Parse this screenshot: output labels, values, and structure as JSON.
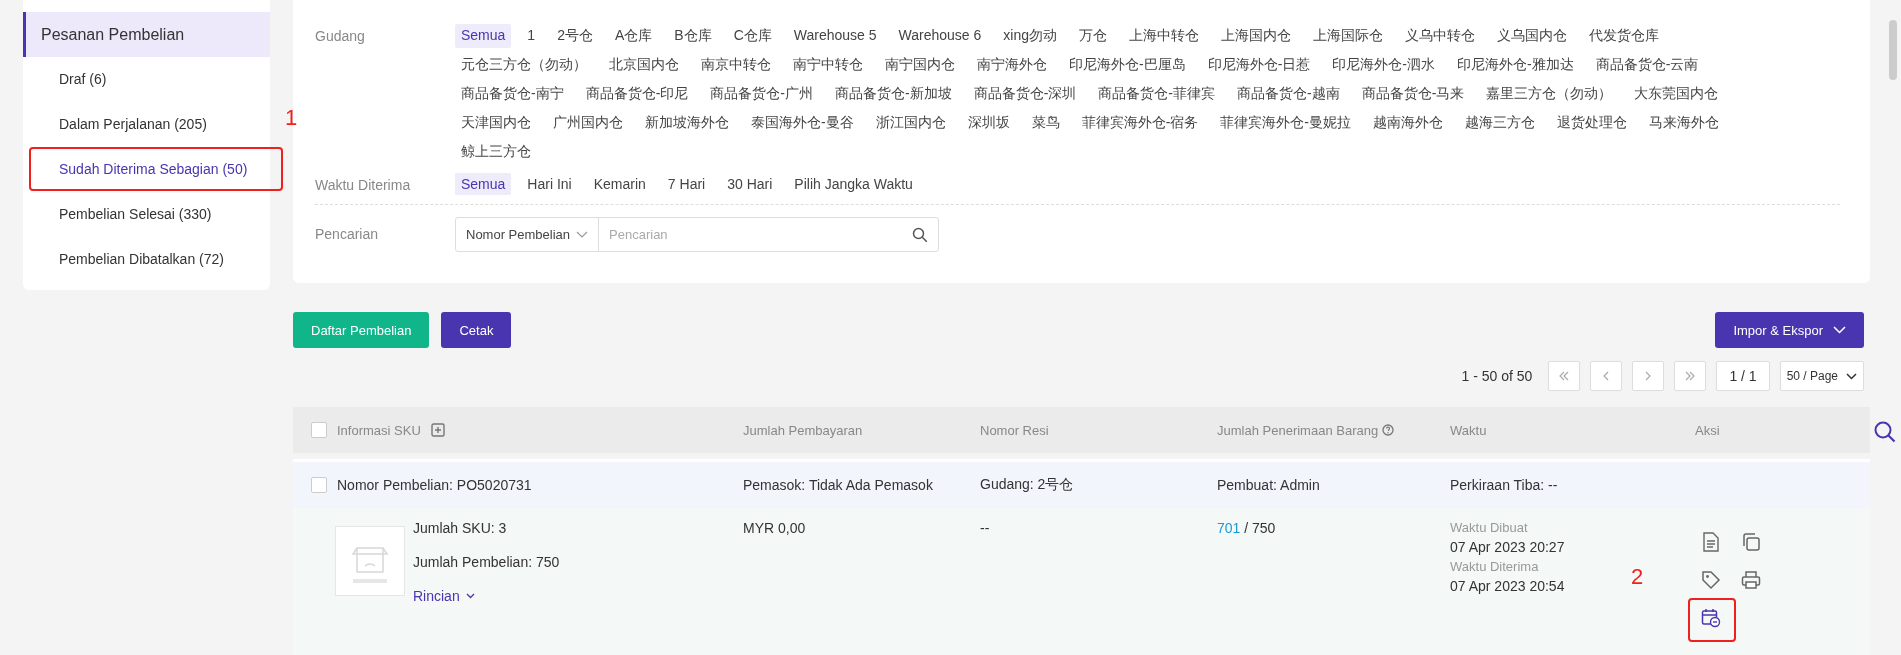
{
  "sidebar": {
    "title": "Pesanan Pembelian",
    "items": [
      {
        "label": "Draf (6)",
        "selected": false
      },
      {
        "label": "Dalam Perjalanan (205)",
        "selected": false
      },
      {
        "label": "Sudah Diterima Sebagian (50)",
        "selected": true,
        "annotation": "1"
      },
      {
        "label": "Pembelian Selesai (330)",
        "selected": false
      },
      {
        "label": "Pembelian Dibatalkan (72)",
        "selected": false
      }
    ]
  },
  "filter": {
    "warehouse": {
      "label": "Gudang",
      "options": [
        {
          "label": "Semua",
          "selected": true
        },
        {
          "label": "1",
          "selected": false
        },
        {
          "label": "2号仓",
          "selected": false
        },
        {
          "label": "A仓库",
          "selected": false
        },
        {
          "label": "B仓库",
          "selected": false
        },
        {
          "label": "C仓库",
          "selected": false
        },
        {
          "label": "Warehouse 5",
          "selected": false
        },
        {
          "label": "Warehouse 6",
          "selected": false
        },
        {
          "label": "xing勿动",
          "selected": false
        },
        {
          "label": "万仓",
          "selected": false
        },
        {
          "label": "上海中转仓",
          "selected": false
        },
        {
          "label": "上海国内仓",
          "selected": false
        },
        {
          "label": "上海国际仓",
          "selected": false
        },
        {
          "label": "义乌中转仓",
          "selected": false
        },
        {
          "label": "义乌国内仓",
          "selected": false
        },
        {
          "label": "代发货仓库",
          "selected": false
        },
        {
          "label": "元仓三方仓（勿动）",
          "selected": false
        },
        {
          "label": "北京国内仓",
          "selected": false
        },
        {
          "label": "南京中转仓",
          "selected": false
        },
        {
          "label": "南宁中转仓",
          "selected": false
        },
        {
          "label": "南宁国内仓",
          "selected": false
        },
        {
          "label": "南宁海外仓",
          "selected": false
        },
        {
          "label": "印尼海外仓-巴厘岛",
          "selected": false
        },
        {
          "label": "印尼海外仓-日惹",
          "selected": false
        },
        {
          "label": "印尼海外仓-泗水",
          "selected": false
        },
        {
          "label": "印尼海外仓-雅加达",
          "selected": false
        },
        {
          "label": "商品备货仓-云南",
          "selected": false
        },
        {
          "label": "商品备货仓-南宁",
          "selected": false
        },
        {
          "label": "商品备货仓-印尼",
          "selected": false
        },
        {
          "label": "商品备货仓-广州",
          "selected": false
        },
        {
          "label": "商品备货仓-新加坡",
          "selected": false
        },
        {
          "label": "商品备货仓-深圳",
          "selected": false
        },
        {
          "label": "商品备货仓-菲律宾",
          "selected": false
        },
        {
          "label": "商品备货仓-越南",
          "selected": false
        },
        {
          "label": "商品备货仓-马来",
          "selected": false
        },
        {
          "label": "嘉里三方仓（勿动）",
          "selected": false
        },
        {
          "label": "大东莞国内仓",
          "selected": false
        },
        {
          "label": "天津国内仓",
          "selected": false
        },
        {
          "label": "广州国内仓",
          "selected": false
        },
        {
          "label": "新加坡海外仓",
          "selected": false
        },
        {
          "label": "泰国海外仓-曼谷",
          "selected": false
        },
        {
          "label": "浙江国内仓",
          "selected": false
        },
        {
          "label": "深圳坂",
          "selected": false
        },
        {
          "label": "菜鸟",
          "selected": false
        },
        {
          "label": "菲律宾海外仓-宿务",
          "selected": false
        },
        {
          "label": "菲律宾海外仓-曼妮拉",
          "selected": false
        },
        {
          "label": "越南海外仓",
          "selected": false
        },
        {
          "label": "越海三方仓",
          "selected": false
        },
        {
          "label": "退货处理仓",
          "selected": false
        },
        {
          "label": "马来海外仓",
          "selected": false
        },
        {
          "label": "鲸上三方仓",
          "selected": false
        }
      ]
    },
    "received_time": {
      "label": "Waktu Diterima",
      "options": [
        {
          "label": "Semua",
          "selected": true
        },
        {
          "label": "Hari Ini",
          "selected": false
        },
        {
          "label": "Kemarin",
          "selected": false
        },
        {
          "label": "7 Hari",
          "selected": false
        },
        {
          "label": "30 Hari",
          "selected": false
        },
        {
          "label": "Pilih Jangka Waktu",
          "selected": false
        }
      ]
    },
    "search": {
      "label": "Pencarian",
      "field_type": "Nomor Pembelian",
      "placeholder": "Pencarian"
    }
  },
  "toolbar": {
    "buttons": [
      "Daftar Pembelian",
      "Cetak"
    ],
    "import_export": "Impor & Ekspor"
  },
  "pagination": {
    "range": "1 - 50 of 50",
    "page": "1 / 1",
    "page_size": "50 / Page"
  },
  "table": {
    "select_all": false,
    "columns": [
      "Informasi SKU",
      "Jumlah Pembayaran",
      "Nomor Resi",
      "Jumlah Penerimaan Barang",
      "Waktu",
      "Aksi"
    ],
    "orders": [
      {
        "checked": false,
        "number": "Nomor Pembelian: PO5020731",
        "supplier": "Pemasok: Tidak Ada Pemasok",
        "warehouse": "Gudang: 2号仓",
        "creator": "Pembuat: Admin",
        "eta": "Perkiraan Tiba: --",
        "sku_count": "Jumlah SKU: 3",
        "purchase_qty": "Jumlah Pembelian: 750",
        "details": "Rincian",
        "amount": "MYR 0,00",
        "tracking": "--",
        "received": "701",
        "total": "/ 750",
        "created_label": "Waktu Dibuat",
        "created": "07 Apr 2023 20:27",
        "received_label": "Waktu Diterima",
        "received_at": "07 Apr 2023 20:54",
        "actions": [
          {
            "kind": "document"
          },
          {
            "kind": "copy"
          },
          {
            "kind": "tag"
          },
          {
            "kind": "print"
          },
          {
            "kind": "schedule",
            "annotation": "2"
          }
        ]
      }
    ]
  }
}
